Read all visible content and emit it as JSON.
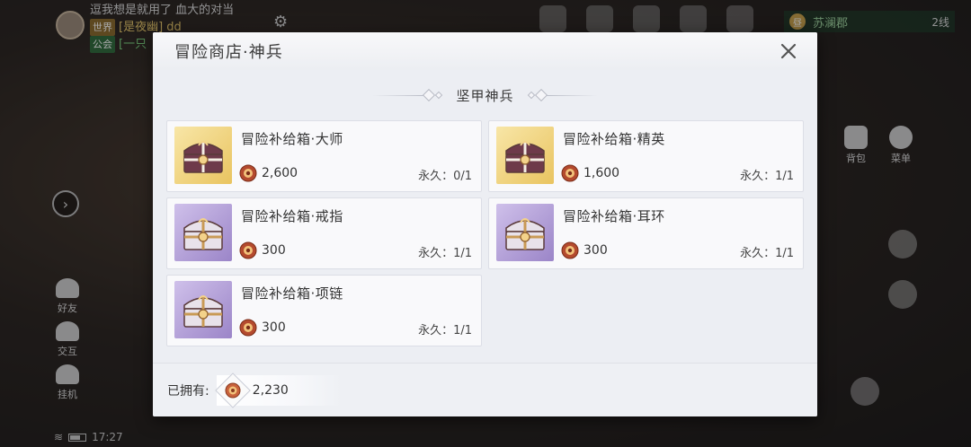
{
  "background": {
    "chat": [
      {
        "channel": "",
        "text": "逗我想是就用了 血大的对当"
      },
      {
        "channel": "世界",
        "text": "[是夜幽] dd"
      },
      {
        "channel": "公会",
        "text": "[一只"
      }
    ],
    "region_day": "昼",
    "region_name": "苏澜郡",
    "region_line": "2线",
    "left_buttons": [
      {
        "label": "好友"
      },
      {
        "label": "交互"
      },
      {
        "label": "挂机"
      }
    ],
    "right_buttons": [
      {
        "label": "背包"
      },
      {
        "label": "菜单"
      }
    ],
    "status_time": "17:27"
  },
  "dialog": {
    "title": "冒险商店·神兵",
    "section_title": "坚甲神兵",
    "items": [
      {
        "name": "冒险补给箱·大师",
        "price": "2,600",
        "limit": "永久：0/1",
        "rarity": "gold"
      },
      {
        "name": "冒险补给箱·精英",
        "price": "1,600",
        "limit": "永久：1/1",
        "rarity": "gold"
      },
      {
        "name": "冒险补给箱·戒指",
        "price": "300",
        "limit": "永久：1/1",
        "rarity": "purple"
      },
      {
        "name": "冒险补给箱·耳环",
        "price": "300",
        "limit": "永久：1/1",
        "rarity": "purple"
      },
      {
        "name": "冒险补给箱·项链",
        "price": "300",
        "limit": "永久：1/1",
        "rarity": "purple"
      }
    ],
    "owned_label": "已拥有:",
    "owned_value": "2,230"
  },
  "colors": {
    "gold_card": "#e9c460",
    "purple_card": "#9b85c8",
    "coin": "#c8623c"
  },
  "icons": {
    "currency": "adventure-coin-icon",
    "close": "close-icon",
    "chest": "supply-chest-icon"
  }
}
